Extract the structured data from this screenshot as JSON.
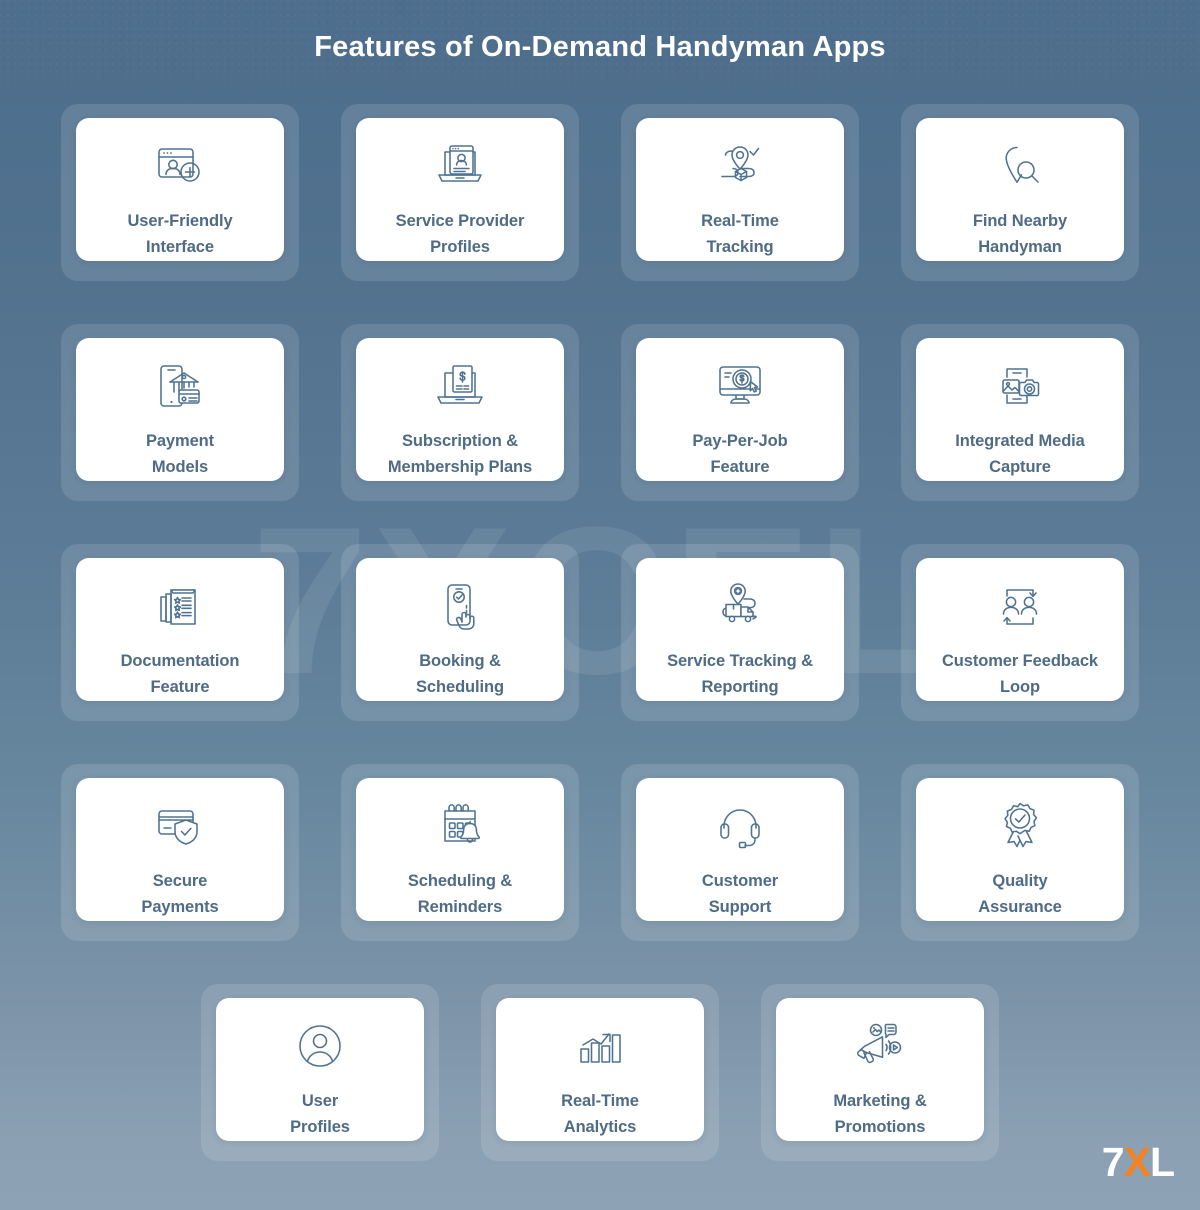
{
  "title": "Features of On-Demand Handyman Apps",
  "watermark": "7XCEL",
  "logo": {
    "part1": "7",
    "part2": "X",
    "part3": "L"
  },
  "colors": {
    "background_top": "#4d6e8c",
    "background_bottom": "#8ba0b3",
    "card_background": "#ffffff",
    "card_frame": "rgba(255,255,255,0.125)",
    "label_text": "#4f6b85",
    "icon_stroke": "#4f7291",
    "title_text": "#ffffff",
    "logo_accent": "#f58220"
  },
  "rows": [
    {
      "cards": [
        {
          "label": "User-Friendly\nInterface",
          "icon": "user-add-window-icon"
        },
        {
          "label": "Service Provider\nProfiles",
          "icon": "laptop-profile-icon"
        },
        {
          "label": "Real-Time\nTracking",
          "icon": "location-package-route-icon"
        },
        {
          "label": "Find Nearby\nHandyman",
          "icon": "map-pin-search-icon"
        }
      ]
    },
    {
      "cards": [
        {
          "label": "Payment\nModels",
          "icon": "mobile-bank-card-icon"
        },
        {
          "label": "Subscription &\nMembership Plans",
          "icon": "laptop-invoice-icon"
        },
        {
          "label": "Pay-Per-Job\nFeature",
          "icon": "monitor-dollar-click-icon"
        },
        {
          "label": "Integrated Media\nCapture",
          "icon": "phone-camera-media-icon"
        }
      ]
    },
    {
      "cards": [
        {
          "label": "Documentation\nFeature",
          "icon": "document-star-list-icon"
        },
        {
          "label": "Booking &\nScheduling",
          "icon": "phone-tap-check-icon"
        },
        {
          "label": "Service Tracking &\nReporting",
          "icon": "truck-gear-pin-icon"
        },
        {
          "label": "Customer Feedback\nLoop",
          "icon": "two-users-loop-icon"
        }
      ]
    },
    {
      "cards": [
        {
          "label": "Secure\nPayments",
          "icon": "card-shield-check-icon"
        },
        {
          "label": "Scheduling &\nReminders",
          "icon": "calendar-bell-icon"
        },
        {
          "label": "Customer\nSupport",
          "icon": "headset-icon"
        },
        {
          "label": "Quality\nAssurance",
          "icon": "award-badge-check-icon"
        }
      ]
    },
    {
      "cards": [
        {
          "label": "User\nProfiles",
          "icon": "user-circle-icon"
        },
        {
          "label": "Real-Time\nAnalytics",
          "icon": "bar-chart-arrow-icon"
        },
        {
          "label": "Marketing &\nPromotions",
          "icon": "megaphone-media-icon"
        }
      ]
    }
  ]
}
